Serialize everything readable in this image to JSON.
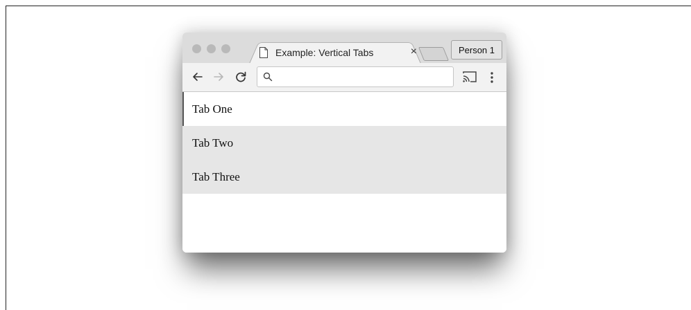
{
  "browser": {
    "tab": {
      "title": "Example: Vertical Tabs",
      "close_label": "×"
    },
    "profile_button": "Person 1",
    "address_bar": {
      "value": "",
      "placeholder": ""
    }
  },
  "page": {
    "tabs": [
      {
        "label": "Tab One",
        "active": true
      },
      {
        "label": "Tab Two",
        "active": false
      },
      {
        "label": "Tab Three",
        "active": false
      }
    ]
  },
  "icons": [
    "document-icon",
    "close-icon",
    "back-arrow-icon",
    "forward-arrow-icon",
    "reload-icon",
    "search-icon",
    "cast-icon",
    "menu-icon"
  ],
  "colors": {
    "active_tab_bg": "#ffffff",
    "inactive_tab_bg": "#e6e6e6",
    "active_tab_marker": "#555555"
  }
}
